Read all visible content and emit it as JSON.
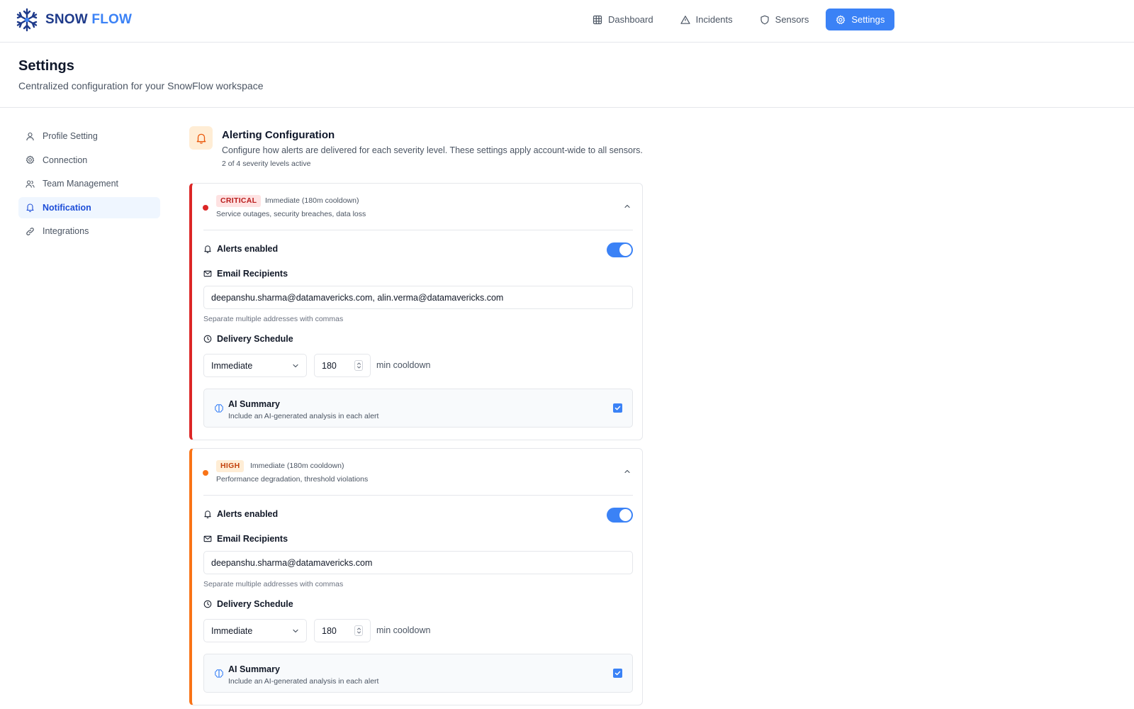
{
  "brand": {
    "part1": "SNOW",
    "part2": "FLOW"
  },
  "nav": [
    {
      "label": "Dashboard",
      "icon": "grid-icon",
      "active": false
    },
    {
      "label": "Incidents",
      "icon": "warning-icon",
      "active": false
    },
    {
      "label": "Sensors",
      "icon": "shield-icon",
      "active": false
    },
    {
      "label": "Settings",
      "icon": "gear-icon",
      "active": true
    }
  ],
  "header": {
    "title": "Settings",
    "subtitle": "Centralized configuration for your SnowFlow workspace"
  },
  "sidebar": {
    "items": [
      {
        "label": "Profile Setting",
        "icon": "user-icon",
        "active": false
      },
      {
        "label": "Connection",
        "icon": "gear-icon",
        "active": false
      },
      {
        "label": "Team Management",
        "icon": "users-icon",
        "active": false
      },
      {
        "label": "Notification",
        "icon": "bell-icon",
        "active": true
      },
      {
        "label": "Integrations",
        "icon": "link-icon",
        "active": false
      }
    ]
  },
  "section": {
    "title": "Alerting Configuration",
    "description": "Configure how alerts are delivered for each severity level. These settings apply account-wide to all sensors.",
    "count": "2 of 4 severity levels active"
  },
  "labels": {
    "alerts_enabled": "Alerts enabled",
    "email_recipients": "Email Recipients",
    "email_hint": "Separate multiple addresses with commas",
    "delivery_schedule": "Delivery Schedule",
    "cooldown_suffix": "min cooldown",
    "ai_title": "AI Summary",
    "ai_desc": "Include an AI-generated analysis in each alert"
  },
  "severities": [
    {
      "name": "CRITICAL",
      "schedule_summary": "Immediate (180m cooldown)",
      "description": "Service outages, security breaches, data loss",
      "color": "#dc2626",
      "alerts_enabled": true,
      "emails": "deepanshu.sharma@datamavericks.com, alin.verma@datamavericks.com",
      "schedule": "Immediate",
      "cooldown": "180",
      "ai_summary": true
    },
    {
      "name": "HIGH",
      "schedule_summary": "Immediate (180m cooldown)",
      "description": "Performance degradation, threshold violations",
      "color": "#f97316",
      "alerts_enabled": true,
      "emails": "deepanshu.sharma@datamavericks.com",
      "schedule": "Immediate",
      "cooldown": "180",
      "ai_summary": true
    }
  ],
  "colors": {
    "accent": "#3b82f6",
    "critical": "#dc2626",
    "high": "#f97316"
  }
}
